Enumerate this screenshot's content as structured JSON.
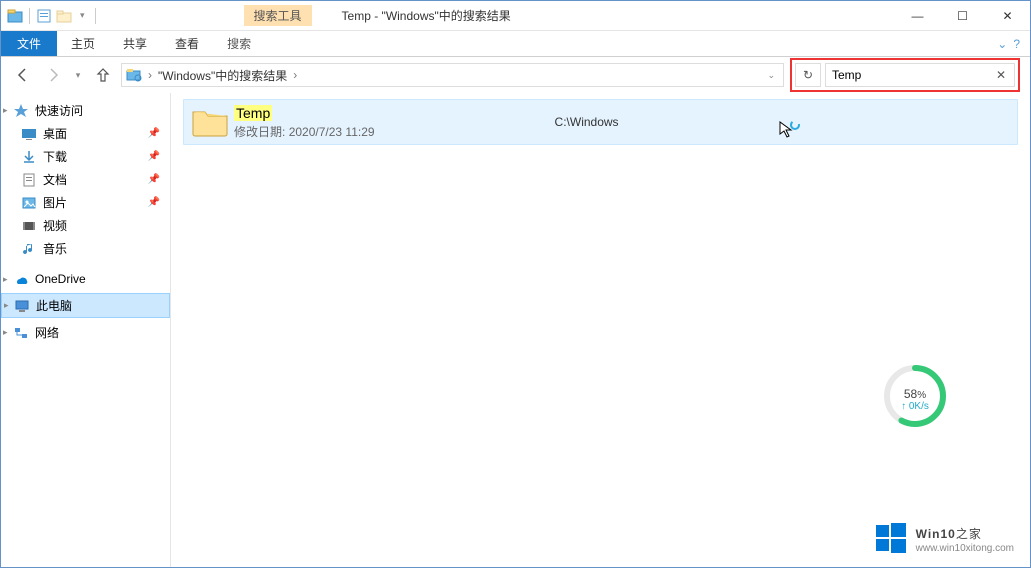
{
  "titlebar": {
    "context_label": "搜索工具",
    "title": "Temp - \"Windows\"中的搜索结果"
  },
  "winbtns": {
    "min": "—",
    "max": "☐",
    "close": "✕"
  },
  "ribbon": {
    "file": "文件",
    "tabs": [
      "主页",
      "共享",
      "查看"
    ],
    "context": "搜索"
  },
  "addressbar": {
    "crumb": "\"Windows\"中的搜索结果",
    "refresh_glyph": "↻"
  },
  "search": {
    "value": "Temp",
    "clear_glyph": "✕"
  },
  "sidebar": {
    "quick_access": "快速访问",
    "items": [
      {
        "label": "桌面",
        "pinned": true
      },
      {
        "label": "下载",
        "pinned": true
      },
      {
        "label": "文档",
        "pinned": true
      },
      {
        "label": "图片",
        "pinned": true
      },
      {
        "label": "视频",
        "pinned": false
      },
      {
        "label": "音乐",
        "pinned": false
      }
    ],
    "onedrive": "OneDrive",
    "this_pc": "此电脑",
    "network": "网络"
  },
  "result": {
    "name": "Temp",
    "date_label": "修改日期:",
    "date_value": "2020/7/23 11:29",
    "path": "C:\\Windows"
  },
  "gauge": {
    "percent": "58",
    "unit": "%",
    "rate": "↑ 0K/s"
  },
  "watermark": {
    "brand": "Win10",
    "suffix": "之家",
    "url": "www.win10xitong.com"
  }
}
